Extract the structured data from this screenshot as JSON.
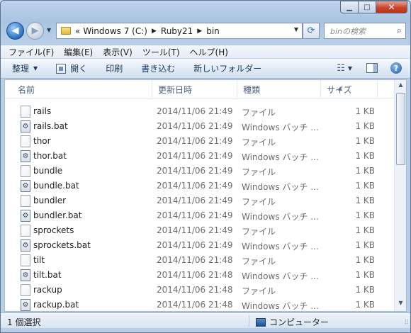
{
  "window": {
    "controls": {
      "minimize": "▁",
      "maximize": "□",
      "close": "✕"
    }
  },
  "nav": {
    "back_icon": "◀",
    "forward_icon": "▶",
    "dropdown_icon": "▼",
    "address": {
      "prefix": "«",
      "crumbs": [
        "Windows 7 (C:)",
        "Ruby21",
        "bin"
      ],
      "separator": "▶",
      "dropdown_icon": "▼"
    },
    "refresh_icon": "⟳",
    "search": {
      "placeholder": "binの検索",
      "icon": "⌕"
    }
  },
  "menubar": {
    "items": [
      "ファイル(F)",
      "編集(E)",
      "表示(V)",
      "ツール(T)",
      "ヘルプ(H)"
    ]
  },
  "commandbar": {
    "organize": "整理",
    "open": "開く",
    "print": "印刷",
    "burn": "書き込む",
    "new_folder": "新しいフォルダー",
    "caret": "▼",
    "view_icon": "☷",
    "help_icon": "?"
  },
  "columns": {
    "name": "名前",
    "date": "更新日時",
    "type": "種類",
    "size": "サイズ",
    "sort_indicator": "▲"
  },
  "files": [
    {
      "name": "rails",
      "date": "2014/11/06 21:49",
      "type": "ファイル",
      "size": "1 KB",
      "kind": "plain"
    },
    {
      "name": "rails.bat",
      "date": "2014/11/06 21:49",
      "type": "Windows バッチ ...",
      "size": "1 KB",
      "kind": "bat"
    },
    {
      "name": "thor",
      "date": "2014/11/06 21:49",
      "type": "ファイル",
      "size": "1 KB",
      "kind": "plain"
    },
    {
      "name": "thor.bat",
      "date": "2014/11/06 21:49",
      "type": "Windows バッチ ...",
      "size": "1 KB",
      "kind": "bat"
    },
    {
      "name": "bundle",
      "date": "2014/11/06 21:49",
      "type": "ファイル",
      "size": "1 KB",
      "kind": "plain"
    },
    {
      "name": "bundle.bat",
      "date": "2014/11/06 21:49",
      "type": "Windows バッチ ...",
      "size": "1 KB",
      "kind": "bat"
    },
    {
      "name": "bundler",
      "date": "2014/11/06 21:49",
      "type": "ファイル",
      "size": "1 KB",
      "kind": "plain"
    },
    {
      "name": "bundler.bat",
      "date": "2014/11/06 21:49",
      "type": "Windows バッチ ...",
      "size": "1 KB",
      "kind": "bat"
    },
    {
      "name": "sprockets",
      "date": "2014/11/06 21:49",
      "type": "ファイル",
      "size": "1 KB",
      "kind": "plain"
    },
    {
      "name": "sprockets.bat",
      "date": "2014/11/06 21:49",
      "type": "Windows バッチ ...",
      "size": "1 KB",
      "kind": "bat"
    },
    {
      "name": "tilt",
      "date": "2014/11/06 21:48",
      "type": "ファイル",
      "size": "1 KB",
      "kind": "plain"
    },
    {
      "name": "tilt.bat",
      "date": "2014/11/06 21:48",
      "type": "Windows バッチ ...",
      "size": "1 KB",
      "kind": "bat"
    },
    {
      "name": "rackup",
      "date": "2014/11/06 21:48",
      "type": "ファイル",
      "size": "1 KB",
      "kind": "plain"
    },
    {
      "name": "rackup.bat",
      "date": "2014/11/06 21:48",
      "type": "Windows バッチ ...",
      "size": "1 KB",
      "kind": "bat"
    }
  ],
  "scrollbar": {
    "up_icon": "▲",
    "down_icon": "▼"
  },
  "statusbar": {
    "selection": "1 個選択",
    "location": "コンピューター",
    "grip_icon": "⠿"
  }
}
